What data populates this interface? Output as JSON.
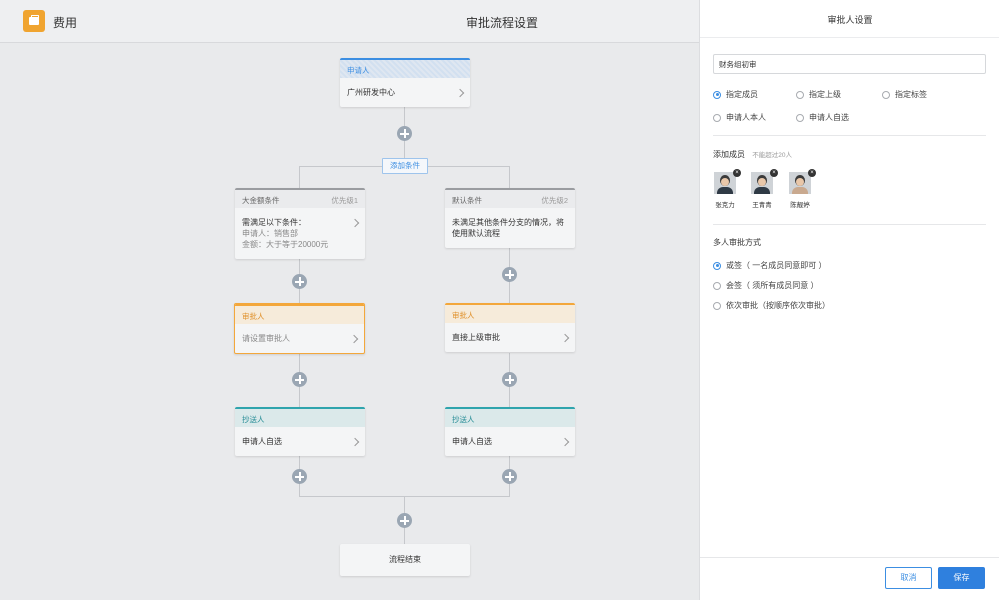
{
  "header": {
    "app_title": "费用",
    "page_title": "审批流程设置"
  },
  "flow": {
    "start": {
      "head": "申请人",
      "body": "广州研发中心"
    },
    "add_condition": "添加条件",
    "left": {
      "condition": {
        "head": "大金额条件",
        "priority": "优先级1",
        "line1": "需满足以下条件：",
        "line2": "申请人：销售部",
        "line3": "金额：大于等于20000元"
      },
      "approver": {
        "head": "审批人",
        "body": "请设置审批人"
      },
      "cc": {
        "head": "抄送人",
        "body": "申请人自选"
      }
    },
    "right": {
      "condition": {
        "head": "默认条件",
        "priority": "优先级2",
        "line1": "未满足其他条件分支的情况，将",
        "line2": "使用默认流程"
      },
      "approver": {
        "head": "审批人",
        "body": "直接上级审批"
      },
      "cc": {
        "head": "抄送人",
        "body": "申请人自选"
      }
    },
    "end": "流程结束"
  },
  "panel": {
    "title": "审批人设置",
    "name_value": "财务组初审",
    "approver_types": [
      {
        "label": "指定成员",
        "selected": true
      },
      {
        "label": "指定上级",
        "selected": false
      },
      {
        "label": "指定标签",
        "selected": false
      },
      {
        "label": "申请人本人",
        "selected": false
      },
      {
        "label": "申请人自选",
        "selected": false
      }
    ],
    "members_title": "添加成员",
    "members_note": "不能超过20人",
    "members": [
      {
        "name": "张克力"
      },
      {
        "name": "王青青"
      },
      {
        "name": "陈靓婷"
      }
    ],
    "remove_glyph": "×",
    "mode_title": "多人审批方式",
    "modes": [
      {
        "label": "或签（ 一名成员同意即可 ）",
        "selected": true
      },
      {
        "label": "会签（ 须所有成员同意 ）",
        "selected": false
      },
      {
        "label": "依次审批（按顺序依次审批）",
        "selected": false
      }
    ],
    "cancel_label": "取消",
    "save_label": "保存"
  },
  "colors": {
    "primary": "#3c8ee2",
    "approver_accent": "#f3a73b",
    "cc_accent": "#2fa4ad",
    "logo": "#f0a430"
  }
}
